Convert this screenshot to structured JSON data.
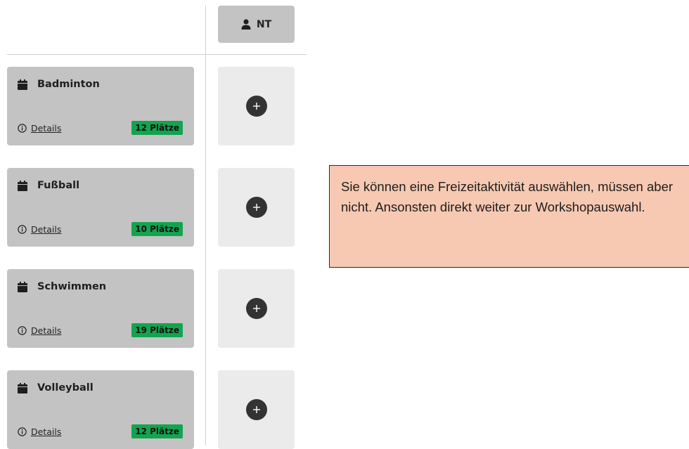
{
  "participant": {
    "initials": "NT",
    "icon": "person-icon"
  },
  "activities": [
    {
      "title": "Badminton",
      "details_label": "Details",
      "places": "12 Plätze"
    },
    {
      "title": "Fußball",
      "details_label": "Details",
      "places": "10 Plätze"
    },
    {
      "title": "Schwimmen",
      "details_label": "Details",
      "places": "19 Plätze"
    },
    {
      "title": "Volleyball",
      "details_label": "Details",
      "places": "12 Plätze"
    }
  ],
  "note": {
    "text": "Sie können eine Freizeitaktivität auswählen, müssen aber nicht. Ansonsten direkt weiter zur Workshopauswahl."
  },
  "colors": {
    "card_bg": "#c3c3c3",
    "slot_bg": "#ebebeb",
    "badge_green": "#13a44f",
    "add_button": "#333333",
    "note_bg": "#f7c9b2"
  }
}
